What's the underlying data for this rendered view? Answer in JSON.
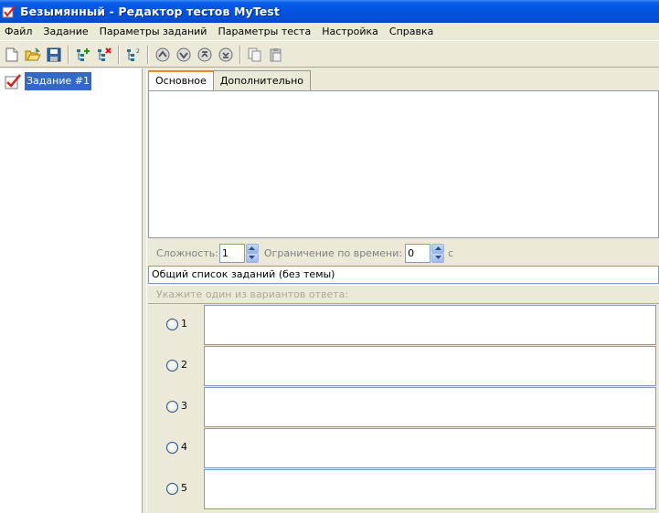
{
  "window": {
    "title": "Безымянный - Редактор тестов MyTest"
  },
  "menu": [
    {
      "label": "Файл",
      "name": "menu-file"
    },
    {
      "label": "Задание",
      "name": "menu-task"
    },
    {
      "label": "Параметры заданий",
      "name": "menu-task-params"
    },
    {
      "label": "Параметры теста",
      "name": "menu-test-params"
    },
    {
      "label": "Настройка",
      "name": "menu-settings"
    },
    {
      "label": "Справка",
      "name": "menu-help"
    }
  ],
  "toolbar": {
    "icons": [
      "new-document-icon",
      "open-folder-icon",
      "save-icon",
      "add-task-icon",
      "delete-task-icon",
      "task-list-icon",
      "move-up-icon",
      "move-down-icon",
      "move-first-icon",
      "move-last-icon",
      "copy-icon",
      "paste-icon"
    ]
  },
  "tree": {
    "items": [
      {
        "label": "Задание #1"
      }
    ]
  },
  "tabs": [
    {
      "label": "Основное",
      "active": true
    },
    {
      "label": "Дополнительно",
      "active": false
    }
  ],
  "params": {
    "difficulty_label": "Сложность:",
    "difficulty_value": "1",
    "time_limit_label": "Ограничение по времени:",
    "time_limit_value": "0",
    "time_unit": "с"
  },
  "topic": {
    "value": "Общий список заданий (без темы)"
  },
  "answers": {
    "hint": "Укажите один из вариантов ответа:",
    "options": [
      {
        "number": "1",
        "text": ""
      },
      {
        "number": "2",
        "text": ""
      },
      {
        "number": "3",
        "text": ""
      },
      {
        "number": "4",
        "text": ""
      },
      {
        "number": "5",
        "text": ""
      }
    ]
  },
  "colors": {
    "titlebar": "#0054e3",
    "selection": "#316ac5",
    "window_bg": "#ece9d8",
    "active_tab_accent": "#e68b2c"
  }
}
